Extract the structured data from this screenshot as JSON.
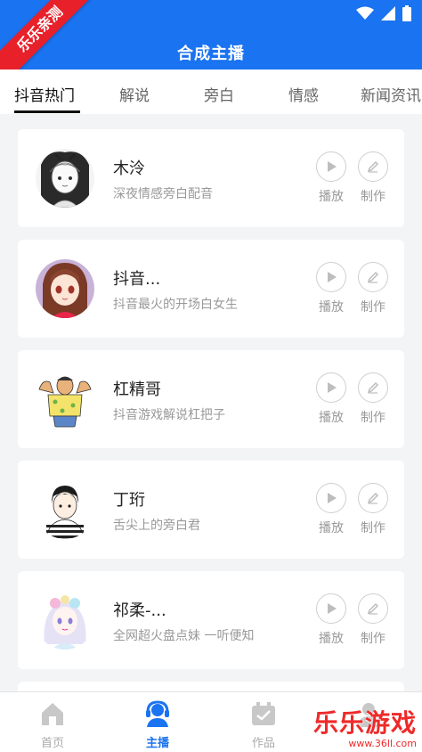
{
  "header": {
    "title": "合成主播"
  },
  "ribbon": {
    "text": "乐乐亲测"
  },
  "tabs": [
    {
      "label": "抖音热门",
      "active": true
    },
    {
      "label": "解说"
    },
    {
      "label": "旁白"
    },
    {
      "label": "情感"
    },
    {
      "label": "新闻资讯"
    }
  ],
  "actions": {
    "play": "播放",
    "make": "制作"
  },
  "anchors": [
    {
      "name": "木泠",
      "desc": "深夜情感旁白配音",
      "avatar_icon": "girl-sketch-avatar"
    },
    {
      "name": "抖音...",
      "desc": "抖音最火的开场白女生",
      "avatar_icon": "anime-girl-avatar"
    },
    {
      "name": "杠精哥",
      "desc": "抖音游戏解说杠把子",
      "avatar_icon": "muscle-man-avatar"
    },
    {
      "name": "丁珩",
      "desc": "舌尖上的旁白君",
      "avatar_icon": "boy-stripes-avatar"
    },
    {
      "name": "祁柔-...",
      "desc": "全网超火盘点妹 一听便知",
      "avatar_icon": "pastel-girl-avatar"
    }
  ],
  "bottom_nav": [
    {
      "label": "首页",
      "icon": "home-icon"
    },
    {
      "label": "主播",
      "icon": "anchor-headset-icon",
      "active": true
    },
    {
      "label": "作品",
      "icon": "works-icon"
    },
    {
      "label": "",
      "icon": "profile-icon"
    }
  ],
  "watermark": {
    "main": "乐乐游戏",
    "url": "www.36ll.com"
  },
  "colors": {
    "primary": "#1a73f0",
    "ribbon": "#e8202a"
  }
}
